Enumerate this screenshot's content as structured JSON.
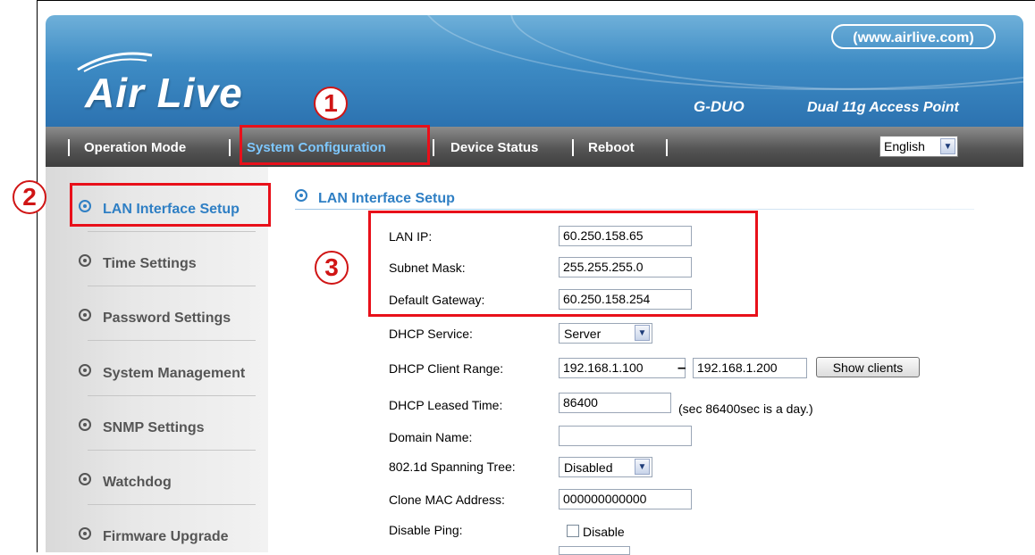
{
  "brand": {
    "logo": "Air Live",
    "url": "(www.airlive.com)",
    "model": "G-DUO",
    "tagline": "Dual 11g Access Point"
  },
  "nav": {
    "items": [
      "Operation Mode",
      "System Configuration",
      "Device Status",
      "Reboot"
    ],
    "language": "English"
  },
  "sidebar": {
    "items": [
      "LAN Interface Setup",
      "Time Settings",
      "Password Settings",
      "System Management",
      "SNMP Settings",
      "Watchdog",
      "Firmware Upgrade"
    ]
  },
  "content": {
    "title": "LAN Interface Setup",
    "lan_ip_label": "LAN IP:",
    "lan_ip": "60.250.158.65",
    "subnet_label": "Subnet Mask:",
    "subnet": "255.255.255.0",
    "gateway_label": "Default Gateway:",
    "gateway": "60.250.158.254",
    "dhcp_service_label": "DHCP Service:",
    "dhcp_service": "Server",
    "dhcp_range_label": "DHCP Client Range:",
    "dhcp_range_start": "192.168.1.100",
    "range_dash": "–",
    "dhcp_range_end": "192.168.1.200",
    "show_clients": "Show clients",
    "lease_label": "DHCP Leased Time:",
    "lease": "86400",
    "lease_hint": "(sec 86400sec is a day.)",
    "domain_label": "Domain Name:",
    "domain": "",
    "stp_label": "802.1d Spanning Tree:",
    "stp": "Disabled",
    "mac_label": "Clone MAC Address:",
    "mac": "000000000000",
    "ping_label": "Disable Ping:",
    "ping_checkbox": "Disable"
  },
  "annotations": {
    "one": "1",
    "two": "2",
    "three": "3"
  },
  "colors": {
    "accent": "#2f7fc4",
    "annotation": "#e8101a",
    "header": "#3d8bc4"
  }
}
